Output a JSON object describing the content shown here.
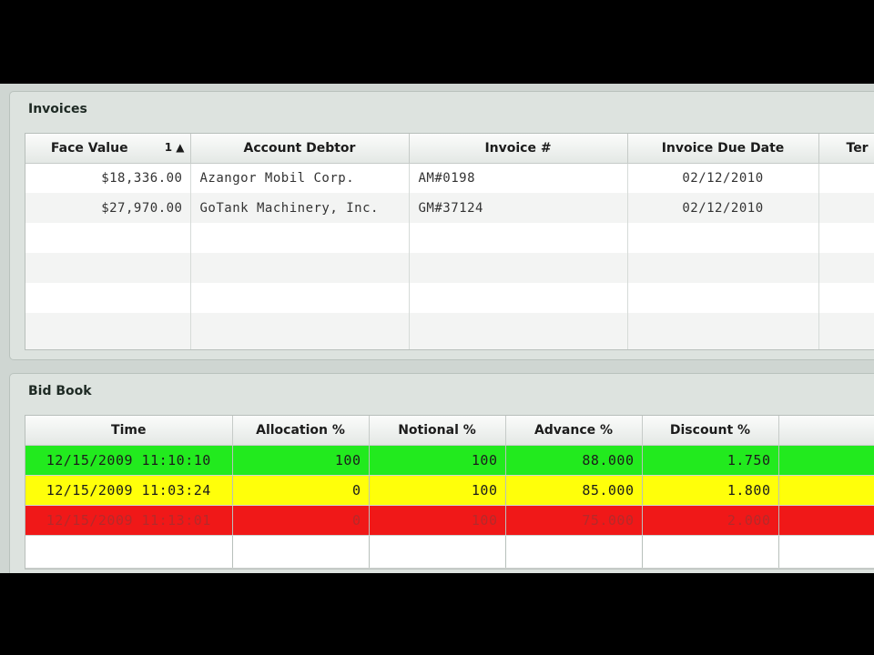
{
  "invoices": {
    "title": "Invoices",
    "columns": [
      "Face Value",
      "Account Debtor",
      "Invoice #",
      "Invoice Due Date",
      "Ter"
    ],
    "sort_indicator": "1 ▲",
    "rows": [
      {
        "face_value": "$18,336.00",
        "account_debtor": "Azangor Mobil Corp.",
        "invoice_no": "AM#0198",
        "due_date": "02/12/2010"
      },
      {
        "face_value": "$27,970.00",
        "account_debtor": "GoTank Machinery, Inc.",
        "invoice_no": "GM#37124",
        "due_date": "02/12/2010"
      }
    ]
  },
  "bid_book": {
    "title": "Bid Book",
    "columns": [
      "Time",
      "Allocation %",
      "Notional %",
      "Advance %",
      "Discount %"
    ],
    "rows": [
      {
        "status": "green",
        "time": "12/15/2009 11:10:10",
        "allocation": "100",
        "notional": "100",
        "advance": "88.000",
        "discount": "1.750"
      },
      {
        "status": "yellow",
        "time": "12/15/2009 11:03:24",
        "allocation": "0",
        "notional": "100",
        "advance": "85.000",
        "discount": "1.800"
      },
      {
        "status": "red",
        "time": "12/15/2009 11:13:01",
        "allocation": "0",
        "notional": "100",
        "advance": "75.000",
        "discount": "2.000"
      }
    ]
  },
  "colors": {
    "green_row": "#22ea1e",
    "yellow_row": "#ffff0a",
    "red_row": "#f01818"
  }
}
